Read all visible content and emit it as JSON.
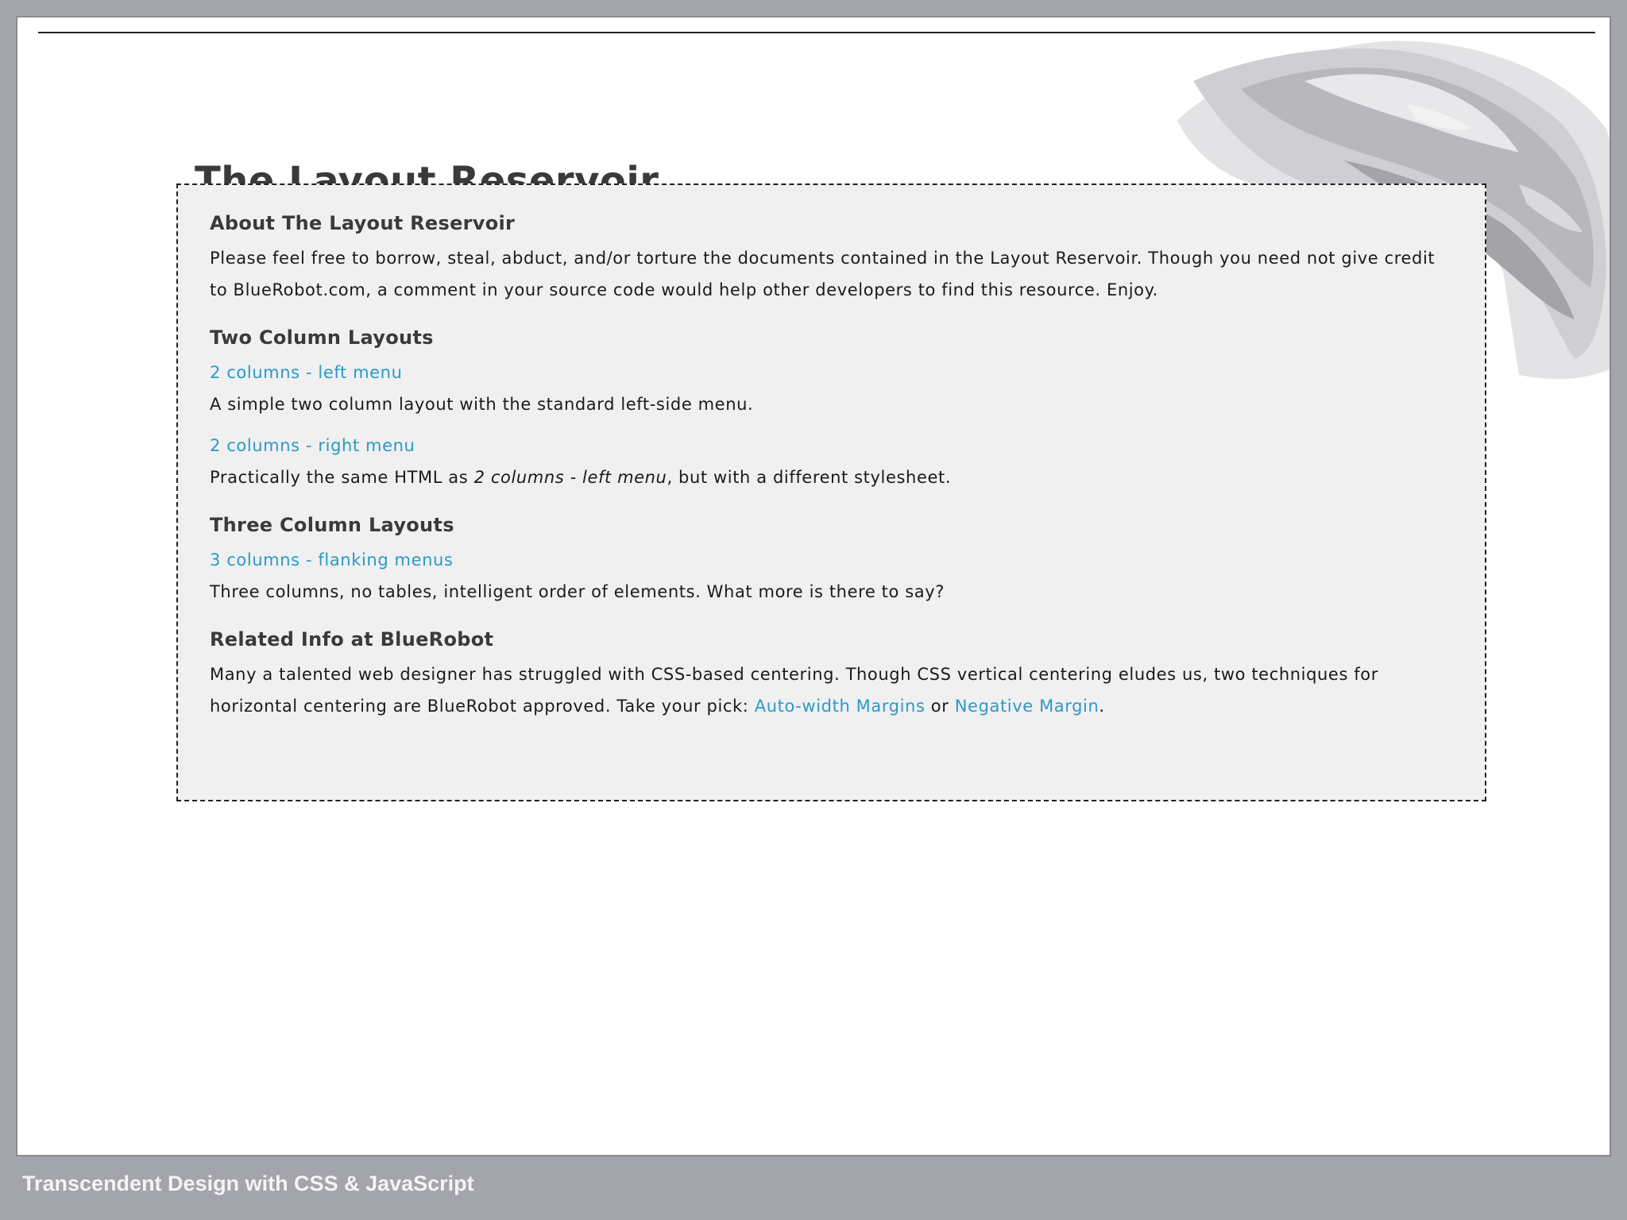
{
  "page": {
    "title": "The Layout Reservoir"
  },
  "about": {
    "heading": "About The Layout Reservoir",
    "text": "Please feel free to borrow, steal, abduct, and/or torture the documents contained in the Layout Reservoir. Though you need not give credit to BlueRobot.com, a comment in your source code would help other developers to find this resource. Enjoy."
  },
  "two_column": {
    "heading": "Two Column Layouts",
    "items": [
      {
        "link": "2 columns - left menu",
        "description": "A simple two column layout with the standard left-side menu."
      },
      {
        "link": "2 columns - right menu",
        "description_before": "Practically the same HTML as ",
        "description_em": "2 columns - left menu",
        "description_after": ", but with a different stylesheet."
      }
    ]
  },
  "three_column": {
    "heading": "Three Column Layouts",
    "items": [
      {
        "link": "3 columns - flanking menus",
        "description": "Three columns, no tables, intelligent order of elements. What more is there to say?"
      }
    ]
  },
  "related": {
    "heading": "Related Info at BlueRobot",
    "text_before": "Many a talented web designer has struggled with CSS-based centering. Though CSS vertical centering eludes us, two techniques for horizontal centering are BlueRobot approved. Take your pick: ",
    "link1": "Auto-width Margins",
    "text_between": " or ",
    "link2": "Negative Margin",
    "text_after": "."
  },
  "footer": {
    "text": "Transcendent Design with CSS & JavaScript"
  },
  "colors": {
    "link": "#2a9ac7",
    "frame": "#a4a4ad",
    "box_background": "#f0f0f1"
  },
  "icons": {
    "decoration": "rock-illustration"
  }
}
